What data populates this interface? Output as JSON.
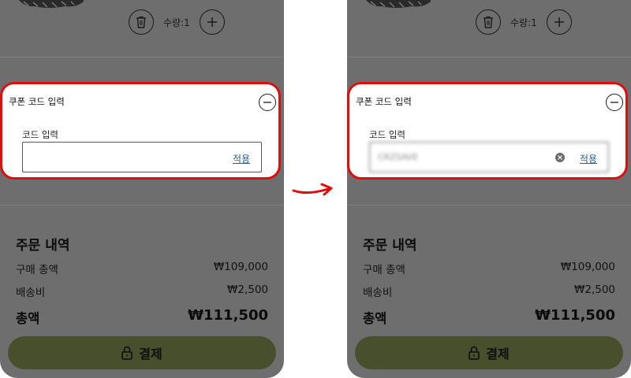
{
  "screens": [
    {
      "state": "empty",
      "quantity_label": "수량:1",
      "coupon": {
        "title": "쿠폰 코드 입력",
        "field_label": "코드 입력",
        "input_value": "",
        "input_placeholder": "",
        "apply_label": "적용"
      },
      "order": {
        "title": "주문 내역",
        "subtotal_label": "구매 총액",
        "subtotal_value": "₩109,000",
        "shipping_label": "배송비",
        "shipping_value": "₩2,500",
        "total_label": "총액",
        "total_value": "₩111,500"
      },
      "pay_label": "결제"
    },
    {
      "state": "filled",
      "quantity_label": "수량:1",
      "coupon": {
        "title": "쿠폰 코드 입력",
        "field_label": "코드 입력",
        "input_value": "CRZSAVE",
        "input_placeholder": "",
        "apply_label": "적용"
      },
      "order": {
        "title": "주문 내역",
        "subtotal_label": "구매 총액",
        "subtotal_value": "₩109,000",
        "shipping_label": "배송비",
        "shipping_value": "₩2,500",
        "total_label": "총액",
        "total_value": "₩111,500"
      },
      "pay_label": "결제"
    }
  ],
  "icons": {
    "delete": "trash-icon",
    "increase": "plus-icon",
    "collapse": "minus-icon",
    "clear": "clear-icon",
    "pay": "lock-icon",
    "transition": "arrow-right-icon"
  },
  "colors": {
    "overlay": "#6e6e6e",
    "highlight": "#e00d0d",
    "link": "#1f5fa8",
    "pay_button": "#474f2c"
  }
}
